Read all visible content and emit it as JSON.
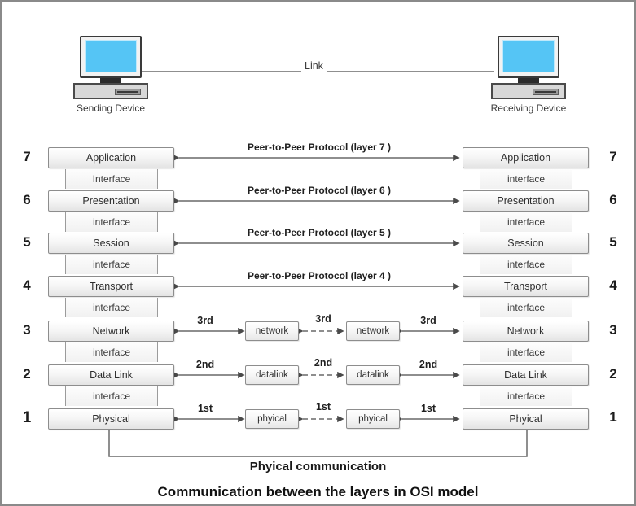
{
  "diagram": {
    "title": "Communication between  the layers in OSI model",
    "physical_communication_label": "Phyical communication",
    "link_label": "Link",
    "colors": {
      "screen_blue": "#55c5f5",
      "box_border": "#8d8d8d",
      "frame_border": "#8a8a8a",
      "line": "#555555",
      "text": "#1f1f1f"
    }
  },
  "devices": {
    "sending": {
      "label": "Sending Device",
      "icon": "computer-icon"
    },
    "receiving": {
      "label": "Receiving Device",
      "icon": "computer-icon"
    }
  },
  "left_stack": {
    "layers": [
      {
        "number": "7",
        "name": "Application"
      },
      {
        "number": "6",
        "name": "Presentation"
      },
      {
        "number": "5",
        "name": "Session"
      },
      {
        "number": "4",
        "name": "Transport"
      },
      {
        "number": "3",
        "name": "Network"
      },
      {
        "number": "2",
        "name": "Data Link"
      },
      {
        "number": "1",
        "name": "Physical"
      }
    ],
    "interfaces": [
      "Interface",
      "interface",
      "interface",
      "interface",
      "interface",
      "interface"
    ]
  },
  "right_stack": {
    "layers": [
      {
        "number": "7",
        "name": "Application"
      },
      {
        "number": "6",
        "name": "Presentation"
      },
      {
        "number": "5",
        "name": "Session"
      },
      {
        "number": "4",
        "name": "Transport"
      },
      {
        "number": "3",
        "name": "Network"
      },
      {
        "number": "2",
        "name": "Data Link"
      },
      {
        "number": "1",
        "name": "Phyical"
      }
    ],
    "interfaces": [
      "interface",
      "interface",
      "interface",
      "interface",
      "interface",
      "interface"
    ]
  },
  "peer_protocols": [
    "Peer-to-Peer Protocol (layer 7 )",
    "Peer-to-Peer Protocol (layer 6 )",
    "Peer-to-Peer Protocol (layer 5 )",
    "Peer-to-Peer Protocol (layer 4 )"
  ],
  "intermediate_rows": [
    {
      "ordinal": "3rd",
      "node_left": "network",
      "node_right": "network",
      "ordinals": [
        "3rd",
        "3rd",
        "3rd"
      ]
    },
    {
      "ordinal": "2nd",
      "node_left": "datalink",
      "node_right": "datalink",
      "ordinals": [
        "2nd",
        "2nd",
        "2nd"
      ]
    },
    {
      "ordinal": "1st",
      "node_left": "phyical",
      "node_right": "phyical",
      "ordinals": [
        "1st",
        "1st",
        "1st"
      ]
    }
  ]
}
